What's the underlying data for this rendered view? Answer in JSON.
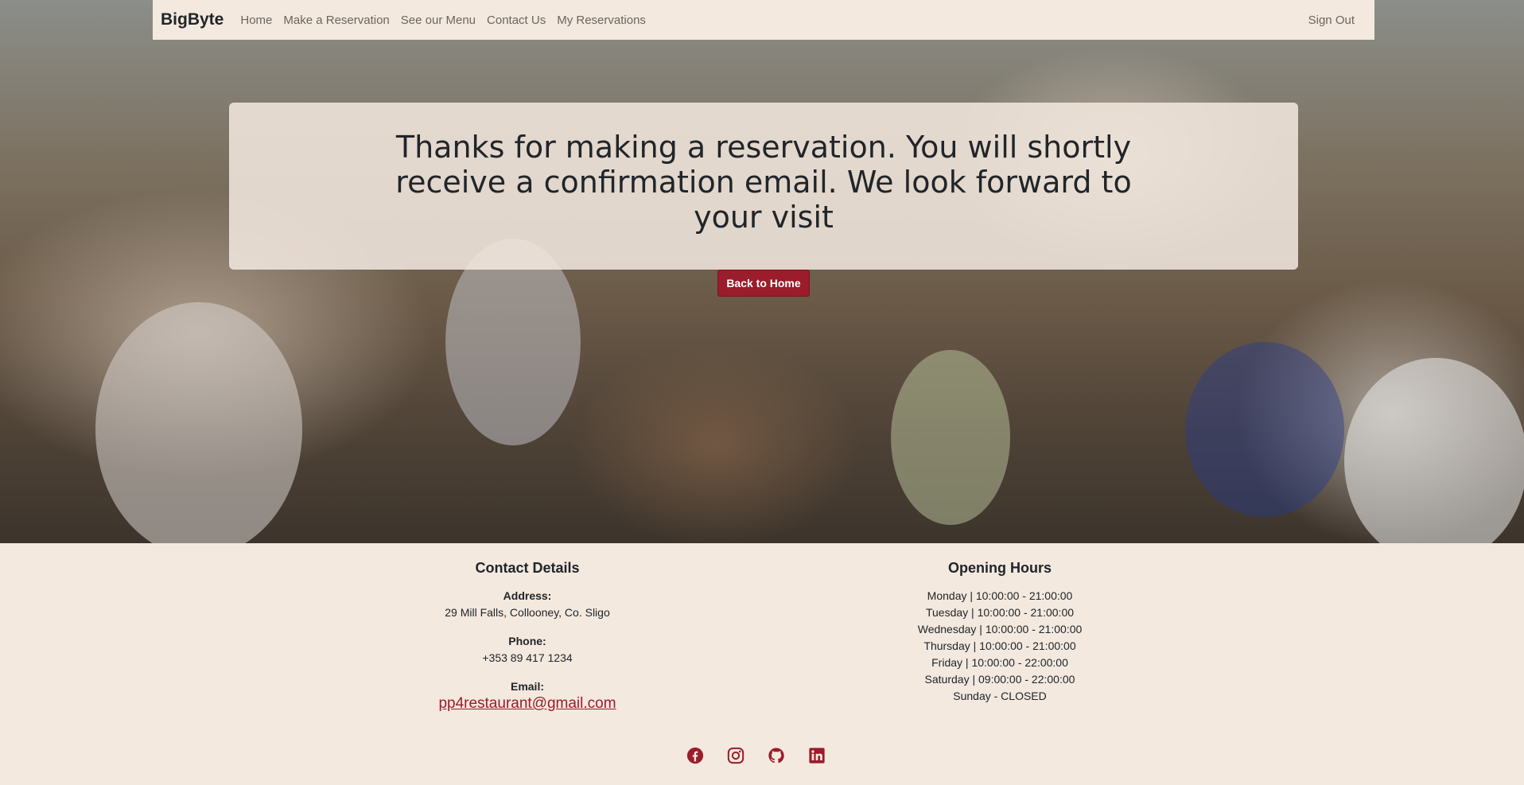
{
  "navbar": {
    "brand": "BigByte",
    "links": [
      "Home",
      "Make a Reservation",
      "See our Menu",
      "Contact Us",
      "My Reservations"
    ],
    "sign_out": "Sign Out"
  },
  "notice": {
    "message": "Thanks for making a reservation. You will shortly receive a confirmation email. We look forward to your visit",
    "button_label": "Back to Home"
  },
  "footer": {
    "contact": {
      "heading": "Contact Details",
      "address_label": "Address:",
      "address": "29 Mill Falls, Collooney, Co. Sligo",
      "phone_label": "Phone:",
      "phone": "+353 89 417 1234",
      "email_label": "Email:",
      "email": "pp4restaurant@gmail.com"
    },
    "hours": {
      "heading": "Opening Hours",
      "lines": [
        "Monday | 10:00:00 - 21:00:00",
        "Tuesday | 10:00:00 - 21:00:00",
        "Wednesday | 10:00:00 - 21:00:00",
        "Thursday | 10:00:00 - 21:00:00",
        "Friday | 10:00:00 - 22:00:00",
        "Saturday | 09:00:00 - 22:00:00",
        "Sunday - CLOSED"
      ]
    },
    "socials": [
      "facebook-icon",
      "instagram-icon",
      "github-icon",
      "linkedin-icon"
    ]
  },
  "colors": {
    "background": "#f3e9df",
    "accent": "#9b1c2a",
    "text": "#212529"
  }
}
